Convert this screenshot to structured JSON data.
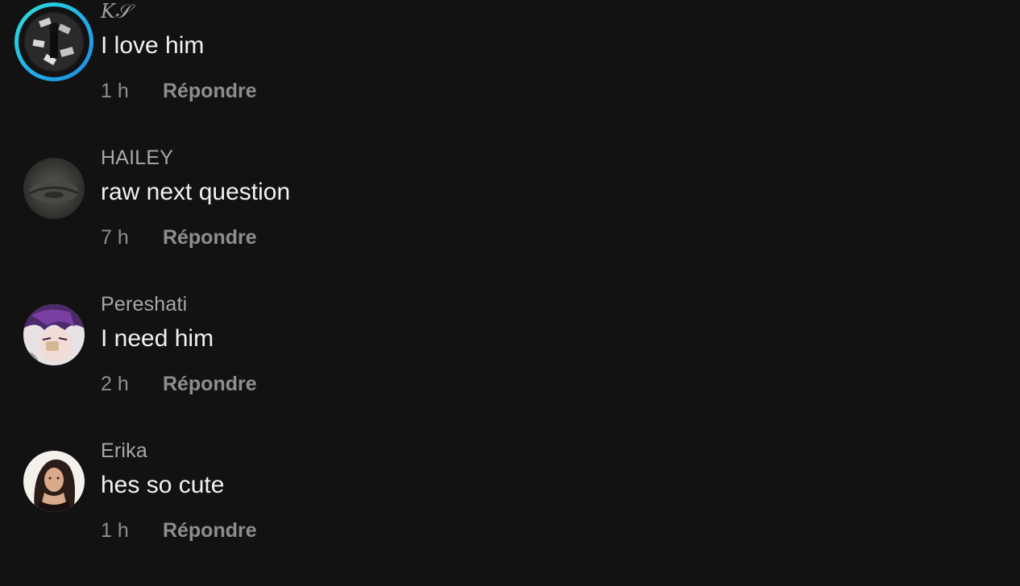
{
  "comments": [
    {
      "username": "K𝒮",
      "text": "I love him",
      "time": "1 h",
      "reply_label": "Répondre",
      "has_story_ring": true
    },
    {
      "username": "HAILEY",
      "text": "raw next question",
      "time": "7 h",
      "reply_label": "Répondre",
      "has_story_ring": false
    },
    {
      "username": "Pereshati",
      "text": "I need him",
      "time": "2 h",
      "reply_label": "Répondre",
      "has_story_ring": false
    },
    {
      "username": "Erika",
      "text": "hes so cute",
      "time": "1 h",
      "reply_label": "Répondre",
      "has_story_ring": false
    }
  ],
  "colors": {
    "background": "#121212",
    "username": "#a8a8a8",
    "comment_text": "#f2f2f2",
    "meta": "#8e8e8e",
    "story_ring": "#23b7e8"
  }
}
